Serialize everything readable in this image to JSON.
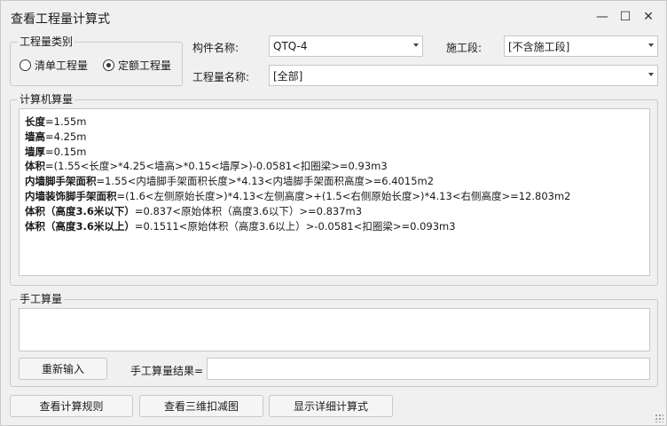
{
  "window": {
    "title": "查看工程量计算式",
    "minimize": "—",
    "maximize": "☐",
    "close": "✕"
  },
  "quantity_type": {
    "legend": "工程量类别",
    "options": [
      {
        "label": "清单工程量",
        "checked": false
      },
      {
        "label": "定额工程量",
        "checked": true
      }
    ]
  },
  "filters": {
    "component_label": "构件名称:",
    "component_value": "QTQ-4",
    "stage_label": "施工段:",
    "stage_value": "[不含施工段]",
    "quantity_name_label": "工程量名称:",
    "quantity_name_value": "[全部]"
  },
  "computer_calc": {
    "legend": "计算机算量",
    "lines": [
      {
        "name": "长度",
        "expr": "=1.55m"
      },
      {
        "name": "墙高",
        "expr": "=4.25m"
      },
      {
        "name": "墙厚",
        "expr": "=0.15m"
      },
      {
        "name": "体积",
        "expr": "=(1.55<长度>*4.25<墙高>*0.15<墙厚>)-0.0581<扣圈梁>=0.93m3"
      },
      {
        "name": "内墙脚手架面积",
        "expr": "=1.55<内墙脚手架面积长度>*4.13<内墙脚手架面积高度>=6.4015m2"
      },
      {
        "name": "内墙装饰脚手架面积",
        "expr": "=(1.6<左侧原始长度>)*4.13<左侧高度>+(1.5<右侧原始长度>)*4.13<右侧高度>=12.803m2"
      },
      {
        "name": "体积（高度3.6米以下）",
        "expr": "=0.837<原始体积（高度3.6以下）>=0.837m3"
      },
      {
        "name": "体积（高度3.6米以上）",
        "expr": "=0.1511<原始体积（高度3.6以上）>-0.0581<扣圈梁>=0.093m3"
      }
    ]
  },
  "manual_calc": {
    "legend": "手工算量",
    "reenter_button": "重新输入",
    "result_label": "手工算量结果=",
    "result_value": ""
  },
  "footer": {
    "rules_button": "查看计算规则",
    "view3d_button": "查看三维扣减图",
    "detail_button": "显示详细计算式"
  }
}
